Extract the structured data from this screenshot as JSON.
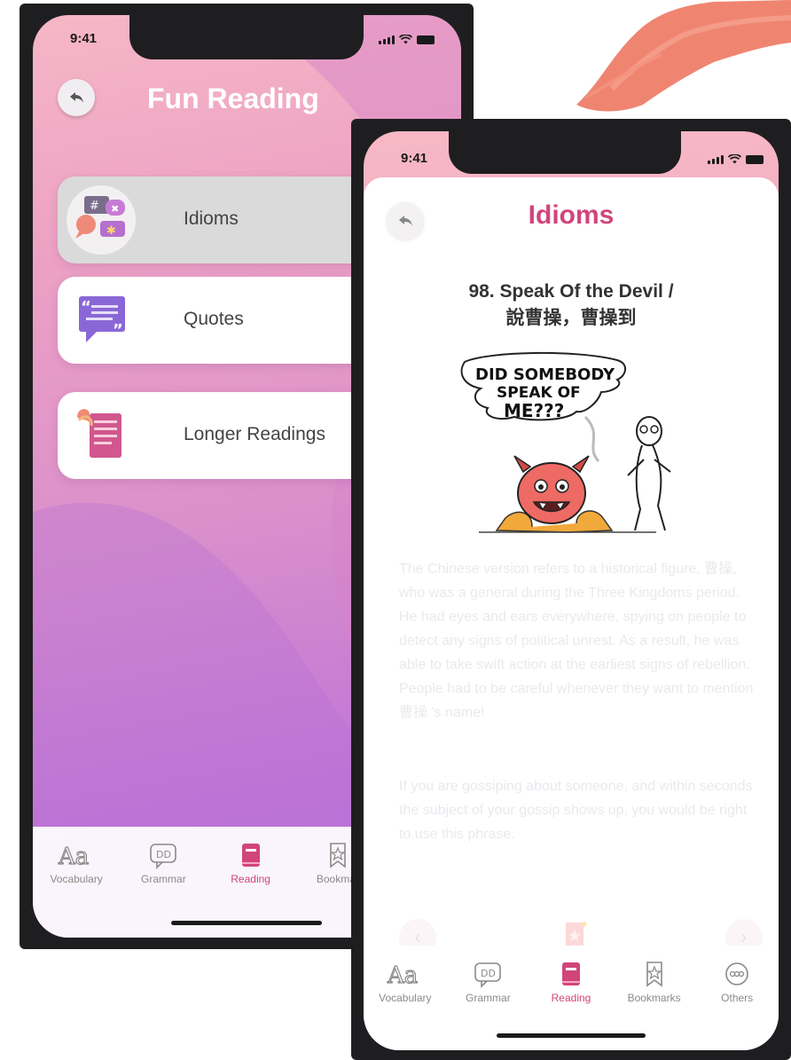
{
  "status_bar": {
    "time": "9:41"
  },
  "list_screen": {
    "title": "Fun Reading",
    "items": [
      {
        "label": "Idioms",
        "icon": "speech-bubbles-icon",
        "selected": true
      },
      {
        "label": "Quotes",
        "icon": "quote-icon",
        "selected": false
      },
      {
        "label": "Longer Readings",
        "icon": "document-icon",
        "selected": false
      }
    ]
  },
  "detail_screen": {
    "title": "Idioms",
    "idiom_title_en": "98. Speak Of the Devil /",
    "idiom_title_zh": "說曹操，曹操到",
    "illustration": {
      "speech_line1": "DID SOMEBODY",
      "speech_line2": "SPEAK OF",
      "speech_line3": "ME???"
    },
    "paragraph1": "The Chinese version refers to a historical figure, 曹操, who was a general during the Three Kingdoms period. He had eyes and ears everywhere, spying on people to detect any signs of political unrest. As a result, he was able to take swift action at the earliest signs of rebellion. People had to be careful whenever they want to mention 曹操 's name!",
    "paragraph2": "If you are gossiping about someone, and within seconds the subject of your gossip shows up, you would be right to use this phrase."
  },
  "tabs": [
    {
      "label": "Vocabulary",
      "icon": "aa-icon"
    },
    {
      "label": "Grammar",
      "icon": "speech-bubble-icon"
    },
    {
      "label": "Reading",
      "icon": "book-icon",
      "active": true
    },
    {
      "label": "Bookmarks",
      "icon": "bookmark-icon"
    },
    {
      "label": "Others",
      "icon": "more-icon"
    }
  ],
  "tabs_left_truncated": "Bookmar",
  "colors": {
    "accent": "#d1457a",
    "gradient_top": "#f6b7c6",
    "gradient_bottom": "#b06ad8"
  }
}
